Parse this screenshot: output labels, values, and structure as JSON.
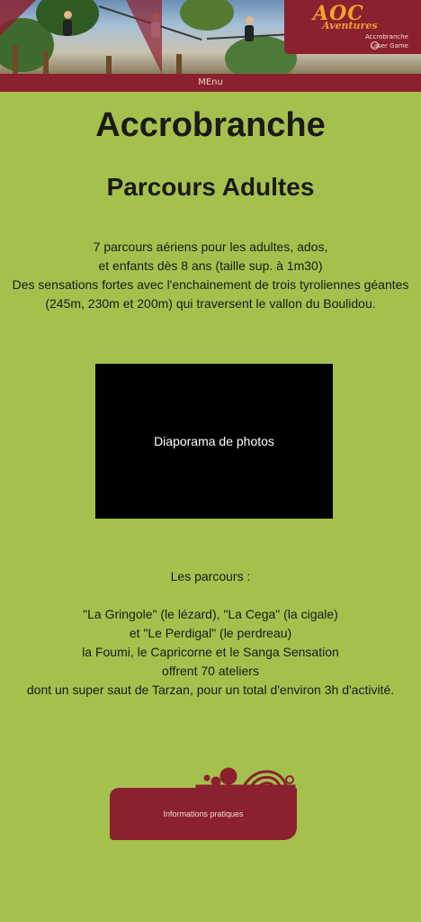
{
  "header": {
    "logo": {
      "brand": "AOC",
      "brand_sub": "Aventures",
      "line1": "Accrobranche",
      "line2": "Laser Game"
    },
    "menu_label": "MEnu"
  },
  "main": {
    "title": "Accrobranche",
    "subtitle": "Parcours Adultes",
    "intro_lines": [
      "7 parcours aériens pour les adultes, ados,",
      "et enfants dès 8 ans (taille sup. à 1m30)",
      "Des sensations fortes avec l'enchainement de trois tyroliennes géantes",
      "(245m, 230m et 200m) qui traversent le vallon du Boulidou."
    ],
    "slideshow_label": "Diaporama de photos",
    "parcours_heading": "Les parcours :",
    "parcours_lines": [
      "\"La Gringole\" (le lézard), \"La Cega\" (la cigale)",
      "et \"Le Perdigal\" (le perdreau)",
      "la Foumi, le Capricorne et le Sanga Sensation",
      "offrent 70 ateliers",
      "dont un super saut de Tarzan, pour un total d'environ 3h d'activité."
    ],
    "info_button_label": "Informations pratiques"
  },
  "colors": {
    "background": "#a4c14e",
    "brand_red": "#8b2030",
    "logo_orange": "#f3a12b",
    "text": "#1a1a1a"
  }
}
